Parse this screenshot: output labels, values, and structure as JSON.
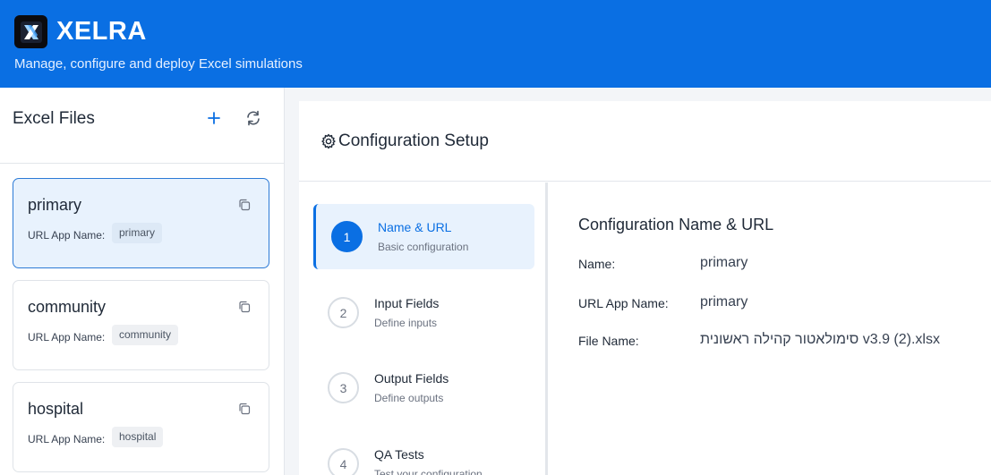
{
  "header": {
    "title": "XELRA",
    "subtitle": "Manage, configure and deploy Excel simulations",
    "brand_color": "#0a6fe3"
  },
  "sidebar": {
    "title": "Excel Files",
    "add_icon": "plus-icon",
    "refresh_icon": "refresh-icon",
    "files": [
      {
        "name": "primary",
        "url_label": "URL App Name:",
        "url_value": "primary",
        "active": true
      },
      {
        "name": "community",
        "url_label": "URL App Name:",
        "url_value": "community",
        "active": false
      },
      {
        "name": "hospital",
        "url_label": "URL App Name:",
        "url_value": "hospital",
        "active": false
      }
    ]
  },
  "main": {
    "title": "Configuration Setup",
    "title_icon": "gear-icon",
    "steps": [
      {
        "num": "1",
        "title": "Name & URL",
        "desc": "Basic configuration",
        "active": true
      },
      {
        "num": "2",
        "title": "Input Fields",
        "desc": "Define inputs",
        "active": false
      },
      {
        "num": "3",
        "title": "Output Fields",
        "desc": "Define outputs",
        "active": false
      },
      {
        "num": "4",
        "title": "QA Tests",
        "desc": "Test your configuration",
        "active": false
      }
    ],
    "details": {
      "title": "Configuration Name & URL",
      "fields": [
        {
          "label": "Name:",
          "value": "primary"
        },
        {
          "label": "URL App Name:",
          "value": "primary"
        },
        {
          "label": "File Name:",
          "value": "סימולאטור קהילה ראשונית v3.9 (2).xlsx"
        }
      ]
    }
  }
}
